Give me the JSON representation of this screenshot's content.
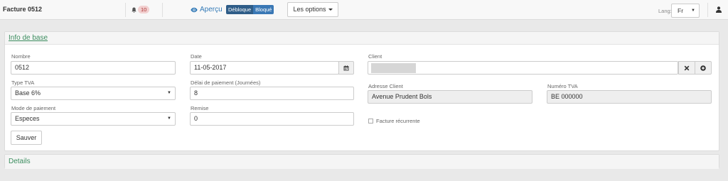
{
  "header": {
    "title": "Facture 0512",
    "notifications_count": "10",
    "apercu_label": "Aperçu",
    "toggle_on": "Débloque",
    "toggle_off": "Bloqué",
    "options_label": "Les options",
    "lang_label": "Lang:",
    "lang_value": "Fr"
  },
  "info_panel": {
    "title": "Info de base",
    "nombre_label": "Nombre",
    "nombre_value": "0512",
    "date_label": "Date",
    "date_value": "11-05-2017",
    "client_label": "Client",
    "type_tva_label": "Type TVA",
    "type_tva_value": "Base 6%",
    "delai_label": "Délai de paiement (Journées)",
    "delai_value": "8",
    "adresse_label": "Adresse Client",
    "adresse_value": "Avenue Prudent Bols",
    "numero_tva_label": "Numéro TVA",
    "numero_tva_value": "BE 000000",
    "mode_label": "Mode de paiement",
    "mode_value": "Especes",
    "remise_label": "Remise",
    "remise_value": "0",
    "recurrente_label": "Facture récurrente",
    "save_label": "Sauver"
  },
  "details_panel": {
    "title": "Details"
  },
  "colors": {
    "accent_blue": "#337ab7",
    "section_green": "#3c8d5f",
    "badge_bg": "#f2d0d0"
  }
}
